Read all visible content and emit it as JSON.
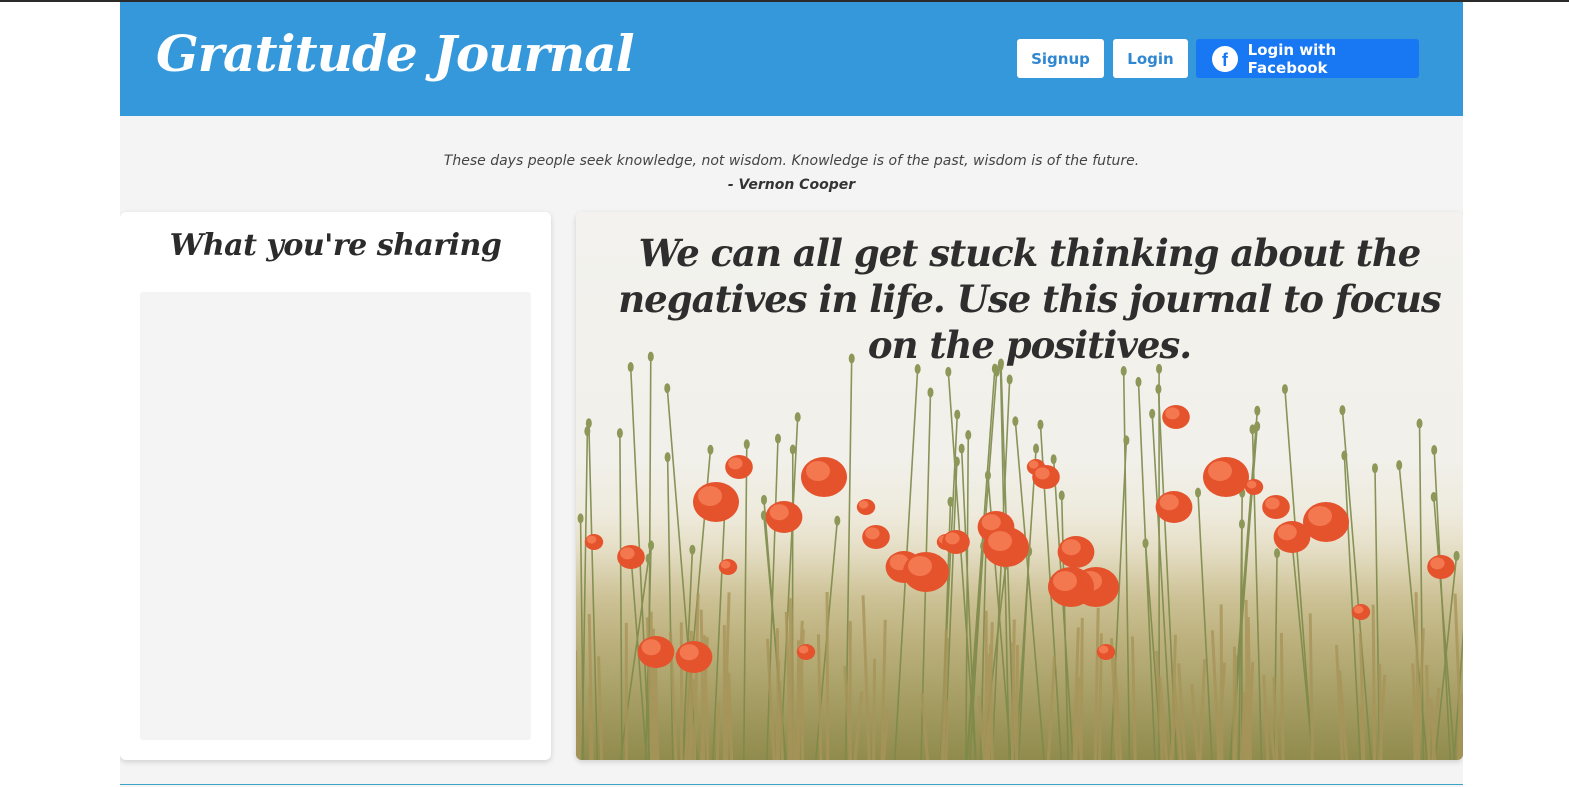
{
  "header": {
    "brand": "Gratitude Journal",
    "signup_label": "Signup",
    "login_label": "Login",
    "facebook_label": "Login with Facebook",
    "facebook_glyph": "f"
  },
  "quote": {
    "text": "These days people seek knowledge, not wisdom. Knowledge is of the past, wisdom is of the future.",
    "author": "- Vernon Cooper"
  },
  "sharing": {
    "title": "What you're sharing"
  },
  "hero": {
    "tagline": "We can all get stuck thinking about the negatives in life. Use this journal to focus on the positives."
  },
  "colors": {
    "header_bg": "#3498db",
    "facebook_blue": "#1877f2",
    "page_bg": "#f4f4f4",
    "poppy_red": "#e5532d"
  },
  "icons": {
    "facebook": "facebook-icon"
  }
}
